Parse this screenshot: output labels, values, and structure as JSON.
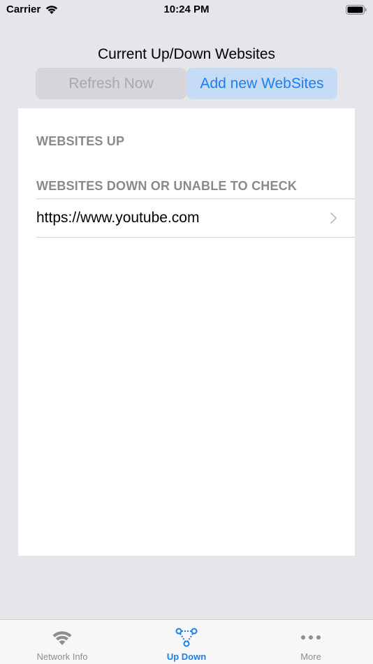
{
  "status_bar": {
    "carrier": "Carrier",
    "time": "10:24 PM"
  },
  "header": {
    "title": "Current Up/Down Websites"
  },
  "segmented": {
    "refresh_label": "Refresh Now",
    "add_label": "Add new WebSites"
  },
  "sections": {
    "up_header": "WEBSITES UP",
    "down_header": "WEBSITES DOWN OR UNABLE TO CHECK",
    "down_items": [
      {
        "url": "https://www.youtube.com"
      }
    ]
  },
  "tabbar": {
    "tabs": [
      {
        "label": "Network Info",
        "icon": "wifi-icon",
        "active": false
      },
      {
        "label": "Up Down",
        "icon": "network-nodes-icon",
        "active": true
      },
      {
        "label": "More",
        "icon": "more-dots-icon",
        "active": false
      }
    ]
  },
  "colors": {
    "accent": "#1a7ff0",
    "background": "#e5e5ea",
    "section_header": "#8a8a8e"
  }
}
